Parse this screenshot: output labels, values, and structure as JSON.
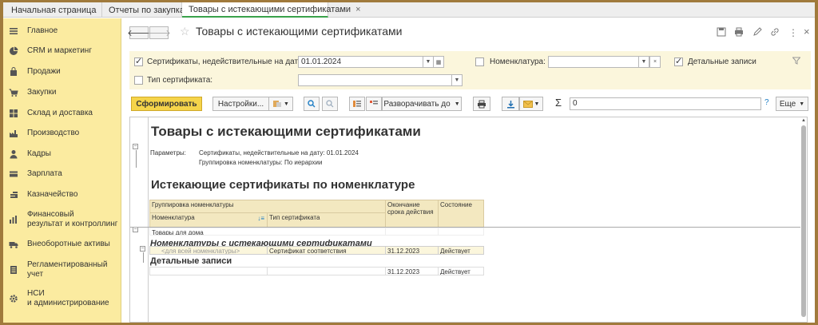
{
  "tabs": {
    "home": "Начальная страница",
    "t1": "Отчеты по закупкам",
    "t2": "Товары с истекающими сертификатами",
    "close": "×"
  },
  "sidebar": {
    "items": [
      {
        "label": "Главное",
        "icon": "menu-icon"
      },
      {
        "label": "CRM и маркетинг",
        "icon": "pie-chart-icon"
      },
      {
        "label": "Продажи",
        "icon": "bag-icon"
      },
      {
        "label": "Закупки",
        "icon": "cart-icon"
      },
      {
        "label": "Склад и доставка",
        "icon": "warehouse-icon"
      },
      {
        "label": "Производство",
        "icon": "factory-icon"
      },
      {
        "label": "Кадры",
        "icon": "person-icon"
      },
      {
        "label": "Зарплата",
        "icon": "wallet-icon"
      },
      {
        "label": "Казначейство",
        "icon": "coins-icon"
      },
      {
        "label": "Финансовый",
        "label2": "результат и контроллинг",
        "icon": "bar-chart-icon"
      },
      {
        "label": "Внеоборотные активы",
        "icon": "truck-icon"
      },
      {
        "label": "Регламентированный",
        "label2": "учет",
        "icon": "document-icon"
      },
      {
        "label": "НСИ",
        "label2": "и администрирование",
        "icon": "gear-icon"
      }
    ]
  },
  "header": {
    "back": "🡐",
    "forward": "🡒",
    "title": "Товары с истекающими сертификатами",
    "more": "⋮",
    "close": "×"
  },
  "params": {
    "cert_label": "Сертификаты, недействительные на дату:",
    "cert_date": "01.01.2024",
    "nom_label": "Номенклатура:",
    "nom_value": "",
    "detail_label": "Детальные записи",
    "type_label": "Тип сертификата:",
    "type_value": ""
  },
  "toolbar": {
    "generate": "Сформировать",
    "settings": "Настройки...",
    "expand": "Разворачивать до",
    "sum_value": "0",
    "help": "?",
    "more": "Еще"
  },
  "report": {
    "title": "Товары с истекающими сертификатами",
    "params_label": "Параметры:",
    "param1": "Сертификаты, недействительные на дату: 01.01.2024",
    "param2": "Группировка номенклатуры: По иерархии",
    "subtitle": "Истекающие сертификаты по номенклатуре",
    "col_group": "Группировка номенклатуры",
    "col_nom": "Номенклатура",
    "col_type": "Тип сертификата",
    "col_end": "Окончание срока действия",
    "col_state": "Состояние",
    "row_home": "Товары для дома",
    "group_italic": "Номенклатуры с истекающими сертификатами",
    "row1_nom": "<для всей номенклатуры>",
    "row1_type": "Сертификат соответствия",
    "row1_end": "31.12.2023",
    "row1_state": "Действует",
    "group_bold": "Детальные записи",
    "row2_end": "31.12.2023",
    "row2_state": "Действует"
  },
  "colors": {
    "sidebar": "#fbeba0",
    "accent_button": "#f5d44a",
    "active_tab": "#3aa24b",
    "param_panel": "#fbf6dc"
  }
}
